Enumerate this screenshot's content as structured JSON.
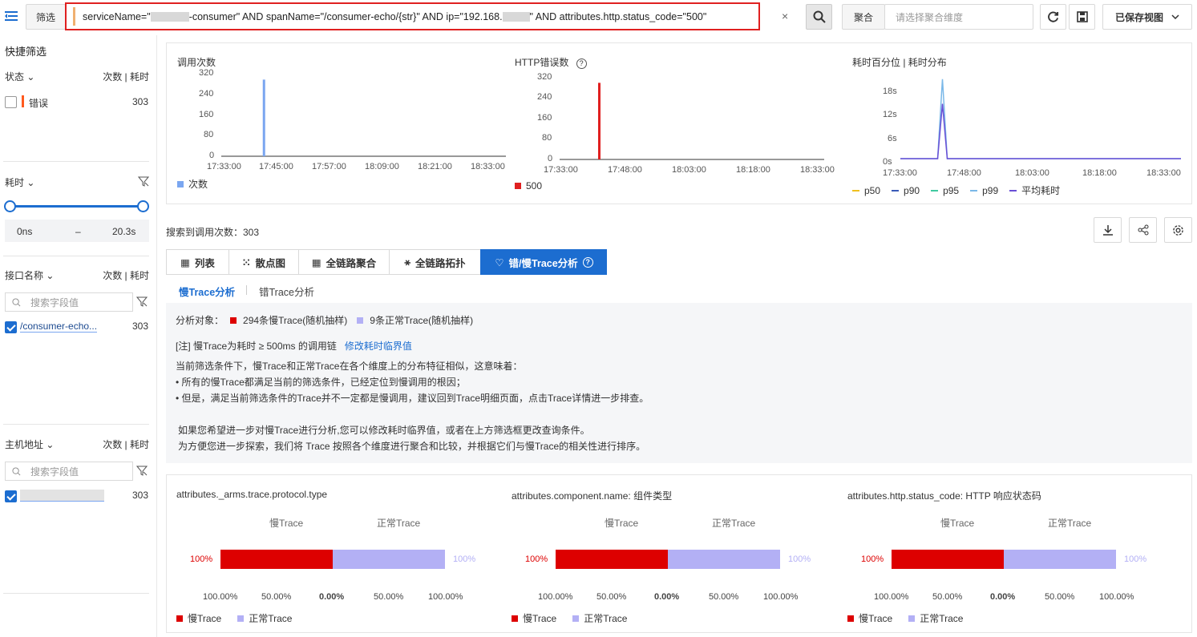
{
  "topbar": {
    "filter_label": "筛选",
    "query_parts": [
      "serviceName=\"",
      "-consumer\" AND spanName=\"/consumer-echo/{str}\" AND ip=\"192.168.",
      "\" AND attributes.http.status_code=\"500\""
    ],
    "clear_icon": "×",
    "aggregate_label": "聚合",
    "aggregate_placeholder": "请选择聚合维度",
    "saved_view_label": "已保存视图",
    "icons": [
      "menu-icon",
      "search-icon",
      "refresh-icon",
      "save-icon",
      "chevron-down-icon"
    ]
  },
  "sidebar": {
    "title": "快捷筛选",
    "status": {
      "label": "状态",
      "right": "次数 | 耗时",
      "item_label": "错误",
      "item_count": "303",
      "checked": false,
      "marker_color": "#ff5a1f"
    },
    "duration": {
      "label": "耗时",
      "min": "0ns",
      "dash": "–",
      "max": "20.3s"
    },
    "endpoint": {
      "label": "接口名称",
      "right": "次数 | 耗时",
      "placeholder": "搜索字段值",
      "item_label": "/consumer-echo...",
      "item_count": "303",
      "checked": true
    },
    "host": {
      "label": "主机地址",
      "right": "次数 | 耗时",
      "placeholder": "搜索字段值",
      "item_count": "303",
      "checked": true
    }
  },
  "charts": {
    "calls": {
      "title": "调用次数",
      "legend": "次数",
      "color": "#7aa6f0"
    },
    "http_errors": {
      "title": "HTTP错误数",
      "legend": "500",
      "color": "#e02020"
    },
    "latency": {
      "title": "耗时百分位 | 耗时分布",
      "legends": [
        "p50",
        "p90",
        "p95",
        "p99",
        "平均耗时"
      ],
      "legend_colors": [
        "#f0c020",
        "#3a5bb8",
        "#40c9a0",
        "#7ab8e8",
        "#6a4fd6"
      ]
    }
  },
  "chart_data": [
    {
      "type": "bar",
      "title": "调用次数",
      "x": [
        "17:33:00",
        "17:45:00",
        "17:57:00",
        "18:09:00",
        "18:21:00",
        "18:33:00"
      ],
      "ylim": [
        0,
        320
      ],
      "yticks": [
        0,
        80,
        160,
        240,
        320
      ],
      "series": [
        {
          "name": "次数",
          "points": [
            [
              "17:42:00",
              303
            ]
          ]
        }
      ]
    },
    {
      "type": "bar",
      "title": "HTTP错误数",
      "x": [
        "17:33:00",
        "17:48:00",
        "18:03:00",
        "18:18:00",
        "18:33:00"
      ],
      "ylim": [
        0,
        320
      ],
      "yticks": [
        0,
        80,
        160,
        240,
        320
      ],
      "series": [
        {
          "name": "500",
          "points": [
            [
              "17:42:00",
              303
            ]
          ]
        }
      ]
    },
    {
      "type": "line",
      "title": "耗时百分位 | 耗时分布",
      "x": [
        "17:33:00",
        "17:48:00",
        "18:03:00",
        "18:18:00",
        "18:33:00"
      ],
      "yticks": [
        "0s",
        "6s",
        "12s",
        "18s"
      ],
      "series": [
        {
          "name": "p99",
          "peak": 20.3,
          "peak_time": "17:42:00"
        },
        {
          "name": "平均耗时",
          "peak": 14,
          "peak_time": "17:42:00"
        }
      ]
    },
    {
      "type": "bar",
      "title": "attributes._arms.trace.protocol.type",
      "categories": [
        "慢Trace",
        "正常Trace"
      ],
      "values": [
        100,
        100
      ],
      "xticks": [
        "100.00%",
        "50.00%",
        "0.00%",
        "50.00%",
        "100.00%"
      ]
    },
    {
      "type": "bar",
      "title": "attributes.component.name: 组件类型",
      "categories": [
        "慢Trace",
        "正常Trace"
      ],
      "values": [
        100,
        100
      ],
      "xticks": [
        "100.00%",
        "50.00%",
        "0.00%",
        "50.00%",
        "100.00%"
      ]
    },
    {
      "type": "bar",
      "title": "attributes.http.status_code: HTTP 响应状态码",
      "categories": [
        "慢Trace",
        "正常Trace"
      ],
      "values": [
        100,
        100
      ],
      "xticks": [
        "100.00%",
        "50.00%",
        "0.00%",
        "50.00%",
        "100.00%"
      ]
    }
  ],
  "results": {
    "count_text": "搜索到调用次数：303"
  },
  "tabs": [
    "列表",
    "散点图",
    "全链路聚合",
    "全链路拓扑",
    "错/慢Trace分析"
  ],
  "subtabs": [
    "慢Trace分析",
    "错Trace分析"
  ],
  "analysis": {
    "target_label": "分析对象：",
    "slow_legend": "294条慢Trace(随机抽样)",
    "normal_legend": "9条正常Trace(随机抽样)",
    "note": "[注] 慢Trace为耗时 ≥ 500ms 的调用链",
    "note_link": "修改耗时临界值",
    "lines": [
      "当前筛选条件下，慢Trace和正常Trace在各个维度上的分布特征相似，这意味着：",
      "• 所有的慢Trace都满足当前的筛选条件，已经定位到慢调用的根因；",
      "• 但是，满足当前筛选条件的Trace并不一定都是慢调用，建议回到Trace明细页面，点击Trace详情进一步排查。",
      "如果您希望进一步对慢Trace进行分析,您可以修改耗时临界值，或者在上方筛选框更改查询条件。",
      "为方便您进一步探索，我们将 Trace 按照各个维度进行聚合和比较，并根据它们与慢Trace的相关性进行排序。"
    ]
  },
  "compare": {
    "panels": [
      {
        "title": "attributes._arms.trace.protocol.type"
      },
      {
        "title": "attributes.component.name: 组件类型"
      },
      {
        "title": "attributes.http.status_code: HTTP 响应状态码"
      }
    ],
    "slow_label": "慢Trace",
    "normal_label": "正常Trace",
    "left_pct": "100%",
    "right_pct": "100%",
    "colors": {
      "slow": "#dd0000",
      "normal": "#b3b0f5"
    }
  }
}
